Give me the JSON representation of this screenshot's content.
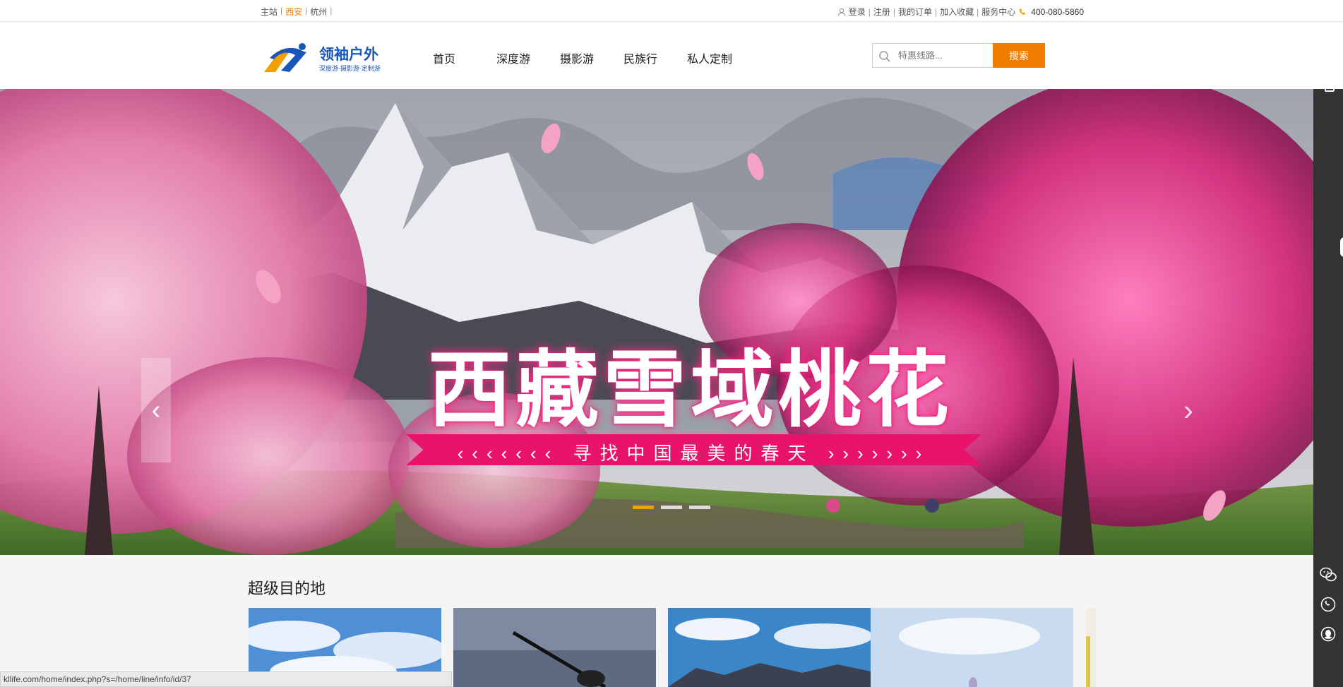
{
  "topbar": {
    "cities": [
      {
        "label": "主站",
        "active": false
      },
      {
        "label": "西安",
        "active": true
      },
      {
        "label": "杭州",
        "active": false
      }
    ],
    "sep": "|",
    "login": "登录",
    "register": "注册",
    "my_orders": "我的订单",
    "add_favorite": "加入收藏",
    "service_center": "服务中心",
    "phone": "400-080-5860"
  },
  "header": {
    "logo_text": "领袖户外",
    "logo_slogan": "深度游·摄影游·定制游",
    "nav": [
      "首页",
      "深度游",
      "摄影游",
      "民族行",
      "私人定制"
    ],
    "search_placeholder": "特惠线路...",
    "search_button": "搜索"
  },
  "banner": {
    "title": "西藏雪域桃花",
    "subtitle": "寻找中国最美的春天",
    "chevrons_left": "‹‹‹‹‹‹‹",
    "chevrons_right": "›››››››",
    "arrow_left": "‹",
    "arrow_right": "›",
    "slides_total": 3,
    "slide_active": 1
  },
  "section": {
    "title": "超级目的地"
  },
  "statusbar": {
    "url": "kllife.com/home/index.php?s=/home/line/info/id/37"
  },
  "colors": {
    "accent": "#f07c00",
    "ribbon": "#e8136b",
    "sidebar": "#333333"
  }
}
